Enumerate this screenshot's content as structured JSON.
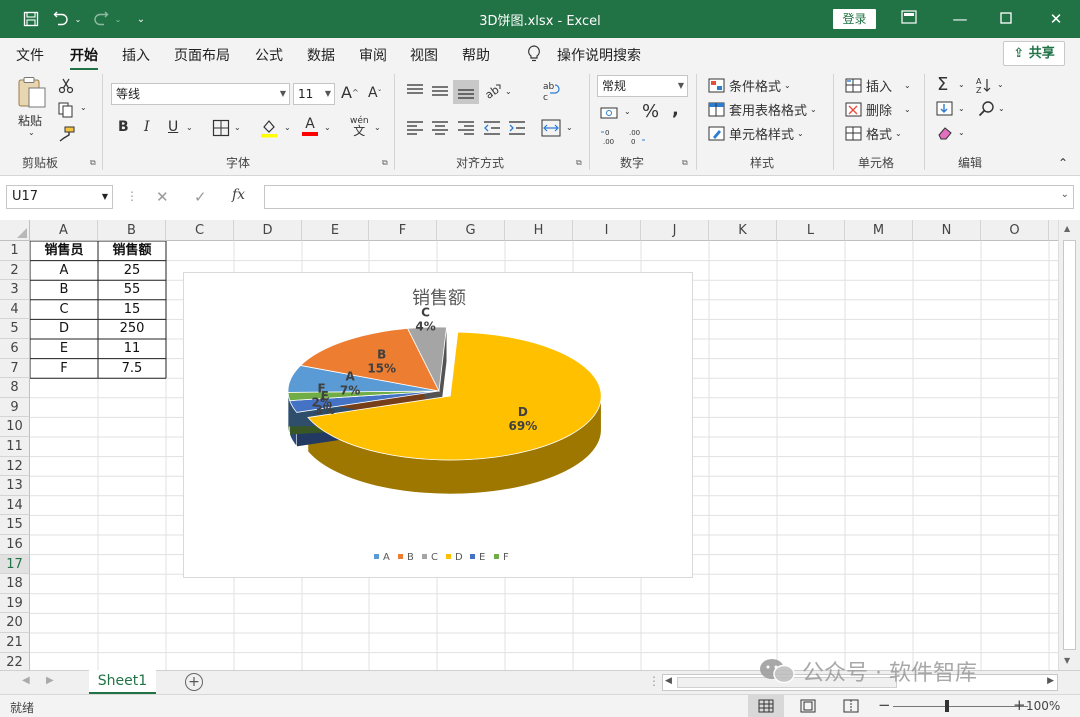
{
  "titlebar": {
    "title": "3D饼图.xlsx  -  Excel",
    "login_label": "登录",
    "icons": [
      "save-icon",
      "undo-icon",
      "redo-icon",
      "customize-qa-icon",
      "ribbon-display-icon",
      "minimize-icon",
      "maximize-icon",
      "close-icon"
    ]
  },
  "menu": {
    "tabs": [
      "文件",
      "开始",
      "插入",
      "页面布局",
      "公式",
      "数据",
      "审阅",
      "视图",
      "帮助"
    ],
    "active_tab": "开始",
    "tell_me": "操作说明搜索",
    "share_label": "共享"
  },
  "ribbon": {
    "clipboard": {
      "paste_label": "粘贴",
      "group_label": "剪贴板"
    },
    "font": {
      "font_name": "等线",
      "font_size": "11",
      "group_label": "字体",
      "bold": "B",
      "italic": "I",
      "underline": "U",
      "grow": "A",
      "shrink": "A",
      "font_color": "A",
      "phonetic": "wén"
    },
    "alignment": {
      "group_label": "对齐方式"
    },
    "number": {
      "format": "常规",
      "percent": "%",
      "comma": ",",
      "group_label": "数字"
    },
    "styles": {
      "conditional": "条件格式",
      "table": "套用表格格式",
      "cell_styles": "单元格样式",
      "group_label": "样式"
    },
    "cells": {
      "insert": "插入",
      "delete": "删除",
      "format": "格式",
      "group_label": "单元格"
    },
    "editing": {
      "group_label": "编辑",
      "sum": "Σ"
    }
  },
  "formula_bar": {
    "name_box": "U17",
    "fx": "fx",
    "formula": ""
  },
  "sheet": {
    "columns": [
      "A",
      "B",
      "C",
      "D",
      "E",
      "F",
      "G",
      "H",
      "I",
      "J",
      "K",
      "L",
      "M",
      "N",
      "O"
    ],
    "rows": [
      "1",
      "2",
      "3",
      "4",
      "5",
      "6",
      "7",
      "8",
      "9",
      "10",
      "11",
      "12",
      "13",
      "14",
      "15",
      "16",
      "17",
      "18",
      "19",
      "20",
      "21",
      "22"
    ],
    "selected_row": "17",
    "table_headers": [
      "销售员",
      "销售额"
    ],
    "table_rows": [
      [
        "A",
        "25"
      ],
      [
        "B",
        "55"
      ],
      [
        "C",
        "15"
      ],
      [
        "D",
        "250"
      ],
      [
        "E",
        "11"
      ],
      [
        "F",
        "7.5"
      ]
    ]
  },
  "chart_data": {
    "type": "pie",
    "title": "销售额",
    "categories": [
      "A",
      "B",
      "C",
      "D",
      "E",
      "F"
    ],
    "values": [
      25,
      55,
      15,
      250,
      11,
      7.5
    ],
    "percent_labels": [
      "7%",
      "15%",
      "4%",
      "69%",
      "3%",
      "2%"
    ],
    "colors": [
      "#5b9bd5",
      "#ed7d31",
      "#a5a5a5",
      "#ffc000",
      "#4472c4",
      "#70ad47"
    ],
    "legend": "bottom",
    "exploded": "D",
    "three_d": true
  },
  "sheet_tabs": {
    "tabs": [
      "Sheet1"
    ],
    "active": "Sheet1",
    "add": "+"
  },
  "status": {
    "ready": "就绪",
    "zoom": "100%",
    "minus": "−",
    "plus": "+"
  },
  "watermark": "公众号 · 软件智库"
}
